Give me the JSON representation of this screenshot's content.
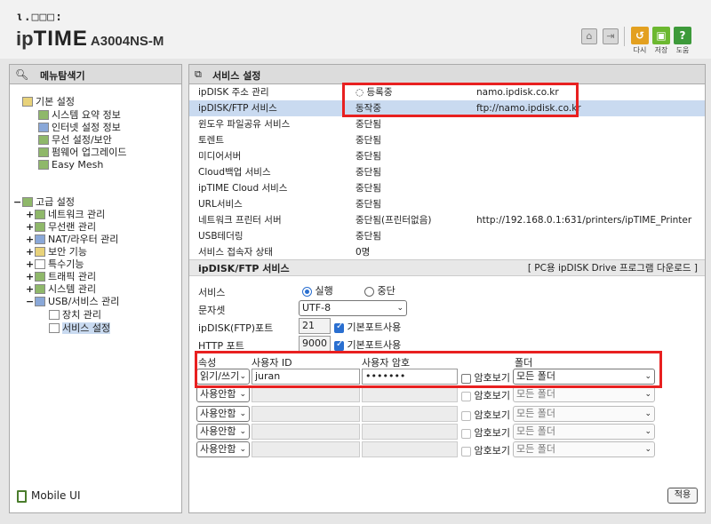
{
  "header": {
    "logo_dots": "ι.□□□:",
    "logo_ip": "ip",
    "logo_time": "TIME",
    "logo_model": "A3004NS-M",
    "labels": [
      "다시",
      "저장",
      "도움"
    ]
  },
  "sidebar": {
    "title": "메뉴탐색기",
    "basic_group": "기본 설정",
    "basic_items": [
      "시스템 요약 정보",
      "인터넷 설정 정보",
      "무선 설정/보안",
      "펌웨어 업그레이드",
      "Easy Mesh"
    ],
    "advanced_group": "고급 설정",
    "advanced_items": [
      "네트워크 관리",
      "무선랜 관리",
      "NAT/라우터 관리",
      "보안 기능",
      "특수기능",
      "트래픽 관리",
      "시스템 관리",
      "USB/서비스 관리"
    ],
    "usb_children": [
      "장치 관리",
      "서비스 설정"
    ],
    "mobile_ui": "Mobile UI"
  },
  "main": {
    "title": "서비스 설정",
    "services": [
      {
        "name": "ipDISK 주소 관리",
        "status": "등록중",
        "detail": "namo.ipdisk.co.kr"
      },
      {
        "name": "ipDISK/FTP 서비스",
        "status": "동작중",
        "detail": "ftp://namo.ipdisk.co.kr"
      },
      {
        "name": "윈도우 파일공유 서비스",
        "status": "중단됨",
        "detail": ""
      },
      {
        "name": "토렌트",
        "status": "중단됨",
        "detail": ""
      },
      {
        "name": "미디어서버",
        "status": "중단됨",
        "detail": ""
      },
      {
        "name": "Cloud백업 서비스",
        "status": "중단됨",
        "detail": ""
      },
      {
        "name": "ipTIME Cloud 서비스",
        "status": "중단됨",
        "detail": ""
      },
      {
        "name": "URL서비스",
        "status": "중단됨",
        "detail": ""
      },
      {
        "name": "네트워크 프린터 서버",
        "status": "중단됨(프린터없음)",
        "detail": "http://192.168.0.1:631/printers/ipTIME_Printer"
      },
      {
        "name": "USB테더링",
        "status": "중단됨",
        "detail": ""
      },
      {
        "name": "서비스 접속자 상태",
        "status": "0명",
        "detail": ""
      }
    ],
    "ftp_section": {
      "title": "ipDISK/FTP 서비스",
      "download_link": "[ PC용 ipDISK Drive 프로그램 다운로드 ]",
      "service_label": "서비스",
      "run_label": "실행",
      "stop_label": "중단",
      "charset_label": "문자셋",
      "charset_value": "UTF-8",
      "ftp_port_label": "ipDISK(FTP)포트",
      "ftp_port_value": "21",
      "http_port_label": "HTTP 포트",
      "http_port_value": "9000",
      "default_port_label": "기본포트사용"
    },
    "users_table": {
      "headers": [
        "속성",
        "사용자 ID",
        "사용자 암호",
        "폴더"
      ],
      "show_pw_label": "암호보기",
      "rows": [
        {
          "attr": "읽기/쓰기",
          "id": "juran",
          "pw": "•••••••",
          "folder": "모든 폴더"
        },
        {
          "attr": "사용안함",
          "id": "",
          "pw": "",
          "folder": "모든 폴더"
        },
        {
          "attr": "사용안함",
          "id": "",
          "pw": "",
          "folder": "모든 폴더"
        },
        {
          "attr": "사용안함",
          "id": "",
          "pw": "",
          "folder": "모든 폴더"
        },
        {
          "attr": "사용안함",
          "id": "",
          "pw": "",
          "folder": "모든 폴더"
        }
      ]
    },
    "apply_label": "적용"
  },
  "colors": {
    "highlight_red": "#e82020",
    "selected_row": "#c9daf0",
    "accent_blue": "#2a6fd0"
  }
}
